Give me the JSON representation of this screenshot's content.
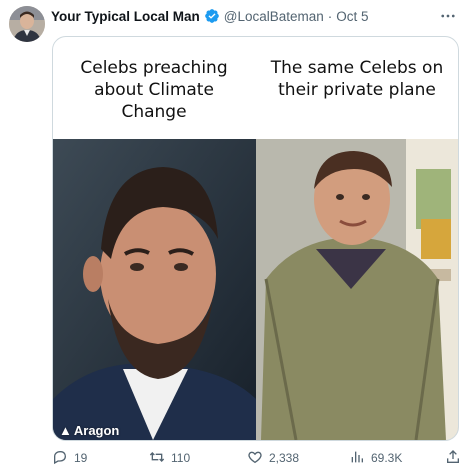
{
  "tweet": {
    "author_name": "Your Typical Local Man",
    "handle": "@LocalBateman",
    "separator": "·",
    "date": "Oct 5",
    "verified_color": "#1d9bf0",
    "more_icon": "more-horizontal-icon"
  },
  "meme": {
    "left_caption": "Celebs preaching about Climate Change",
    "right_caption": "The same Celebs on their private plane",
    "watermark": "Aragon"
  },
  "actions": {
    "replies": "19",
    "retweets": "110",
    "likes": "2,338",
    "views": "69.3K",
    "icons": [
      "reply-icon",
      "retweet-icon",
      "like-icon",
      "views-icon",
      "share-icon"
    ]
  }
}
